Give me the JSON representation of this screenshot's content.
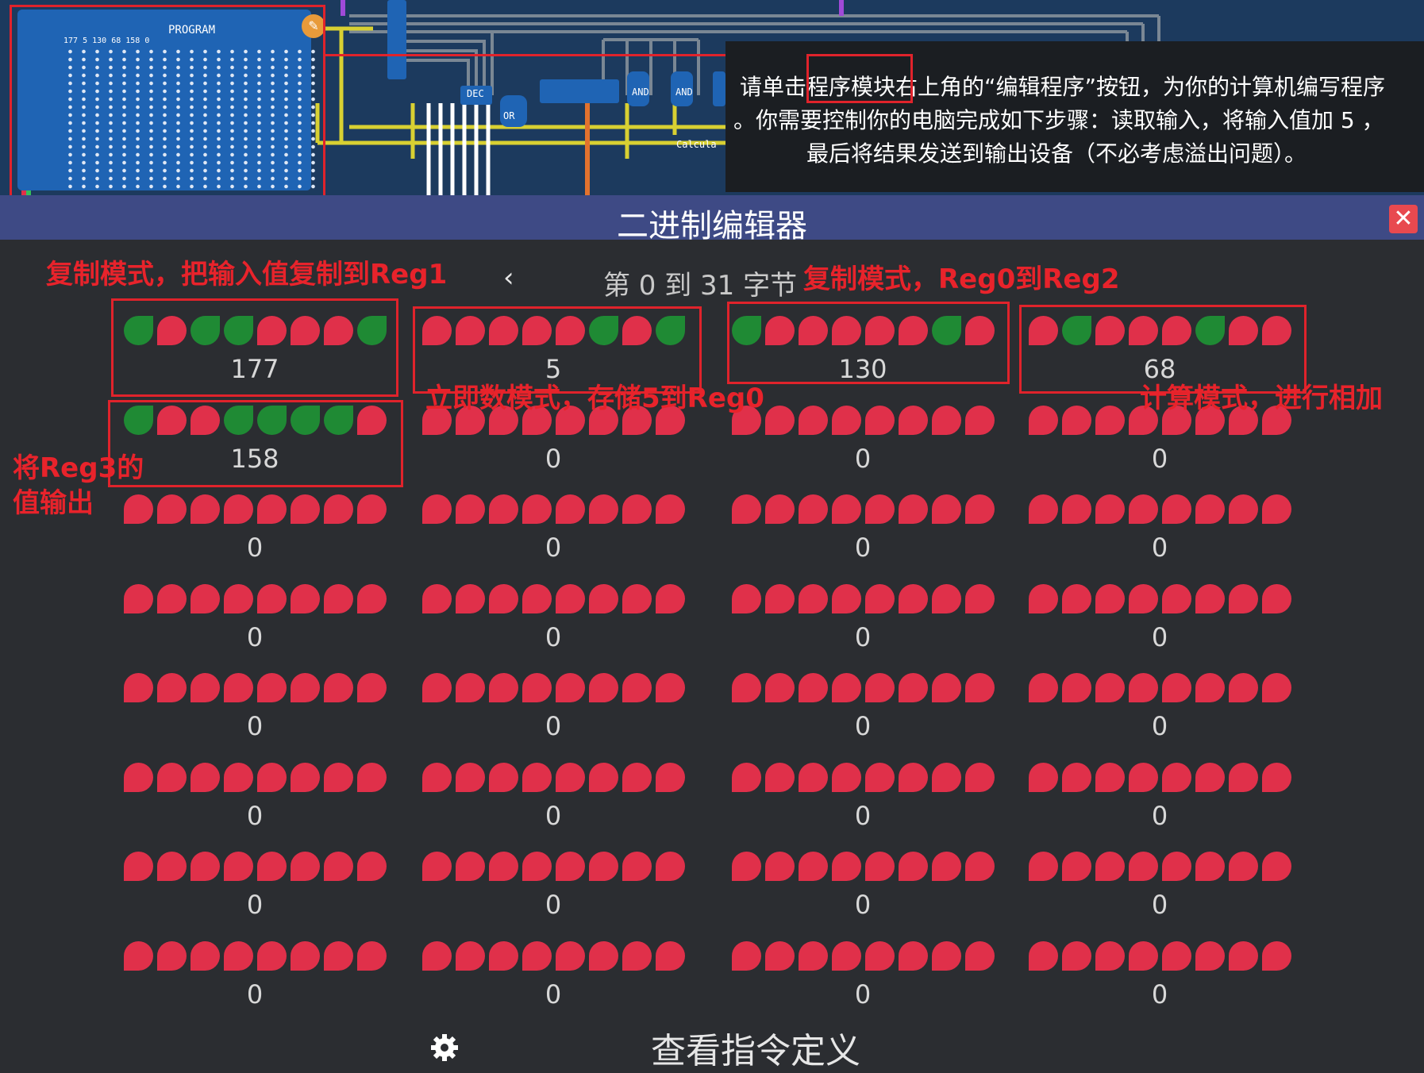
{
  "circuit": {
    "program_title": "PROGRAM",
    "program_header": "177 5 130 68 158 0",
    "component_labels": [
      "DEC",
      "OR",
      "AND",
      "AND",
      "Calcula"
    ],
    "instructions_lines": [
      "请单击程序模块右上角的“编辑程序”按钮，为你的计算机编写程序",
      "。你需要控制你的电脑完成如下步骤：读取输入，将输入值加 5 ，",
      "最后将结果发送到输出设备（不必考虑溢出问题）。"
    ]
  },
  "editor": {
    "title": "二进制编辑器",
    "close_icon": "close-icon",
    "nav_prev_icon": "chevron-left-icon",
    "page_label": "第 0 到 31 字节",
    "footer_link": "查看指令定义",
    "settings_icon": "gear-icon",
    "bytes": [
      177,
      5,
      130,
      68,
      158,
      0,
      0,
      0,
      0,
      0,
      0,
      0,
      0,
      0,
      0,
      0,
      0,
      0,
      0,
      0,
      0,
      0,
      0,
      0,
      0,
      0,
      0,
      0,
      0,
      0,
      0,
      0
    ]
  },
  "annotations": {
    "a1": "复制模式，把输入值复制到Reg1",
    "a2": "复制模式，Reg0到Reg2",
    "a3": "立即数模式，存储5到Reg0",
    "a4": "计算模式，进行相加",
    "a5_line1": "将Reg3的",
    "a5_line2": "值输出"
  },
  "colors": {
    "bit_on": "#1f8a34",
    "bit_off": "#e0304a",
    "annotation": "#e8232b",
    "titlebar": "#3e4a85",
    "background": "#2b2d31"
  }
}
